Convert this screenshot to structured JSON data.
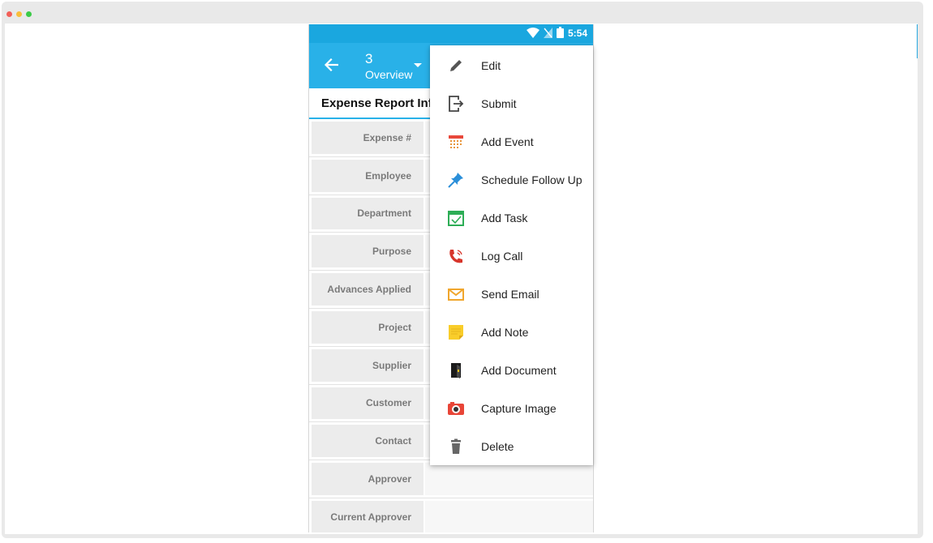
{
  "status_bar": {
    "time": "5:54"
  },
  "app_bar": {
    "title_number": "3",
    "title_subtitle": "Overview"
  },
  "section": {
    "title": "Expense Report Info"
  },
  "fields": [
    {
      "label": "Expense #"
    },
    {
      "label": "Employee"
    },
    {
      "label": "Department"
    },
    {
      "label": "Purpose"
    },
    {
      "label": "Advances Applied"
    },
    {
      "label": "Project"
    },
    {
      "label": "Supplier"
    },
    {
      "label": "Customer"
    },
    {
      "label": "Contact"
    },
    {
      "label": "Approver"
    },
    {
      "label": "Current Approver"
    }
  ],
  "menu": {
    "items": [
      {
        "label": "Edit",
        "icon": "pencil-icon"
      },
      {
        "label": "Submit",
        "icon": "submit-icon"
      },
      {
        "label": "Add Event",
        "icon": "calendar-icon"
      },
      {
        "label": "Schedule Follow Up",
        "icon": "pushpin-icon"
      },
      {
        "label": "Add Task",
        "icon": "task-check-icon"
      },
      {
        "label": "Log Call",
        "icon": "phone-icon"
      },
      {
        "label": "Send Email",
        "icon": "envelope-icon"
      },
      {
        "label": "Add Note",
        "icon": "sticky-note-icon"
      },
      {
        "label": "Add Document",
        "icon": "document-icon"
      },
      {
        "label": "Capture Image",
        "icon": "camera-icon"
      },
      {
        "label": "Delete",
        "icon": "trash-icon"
      }
    ]
  },
  "colors": {
    "app_bar": "#29b1e8",
    "status_bar": "#1aa7df",
    "accent": "#29b1e8"
  }
}
